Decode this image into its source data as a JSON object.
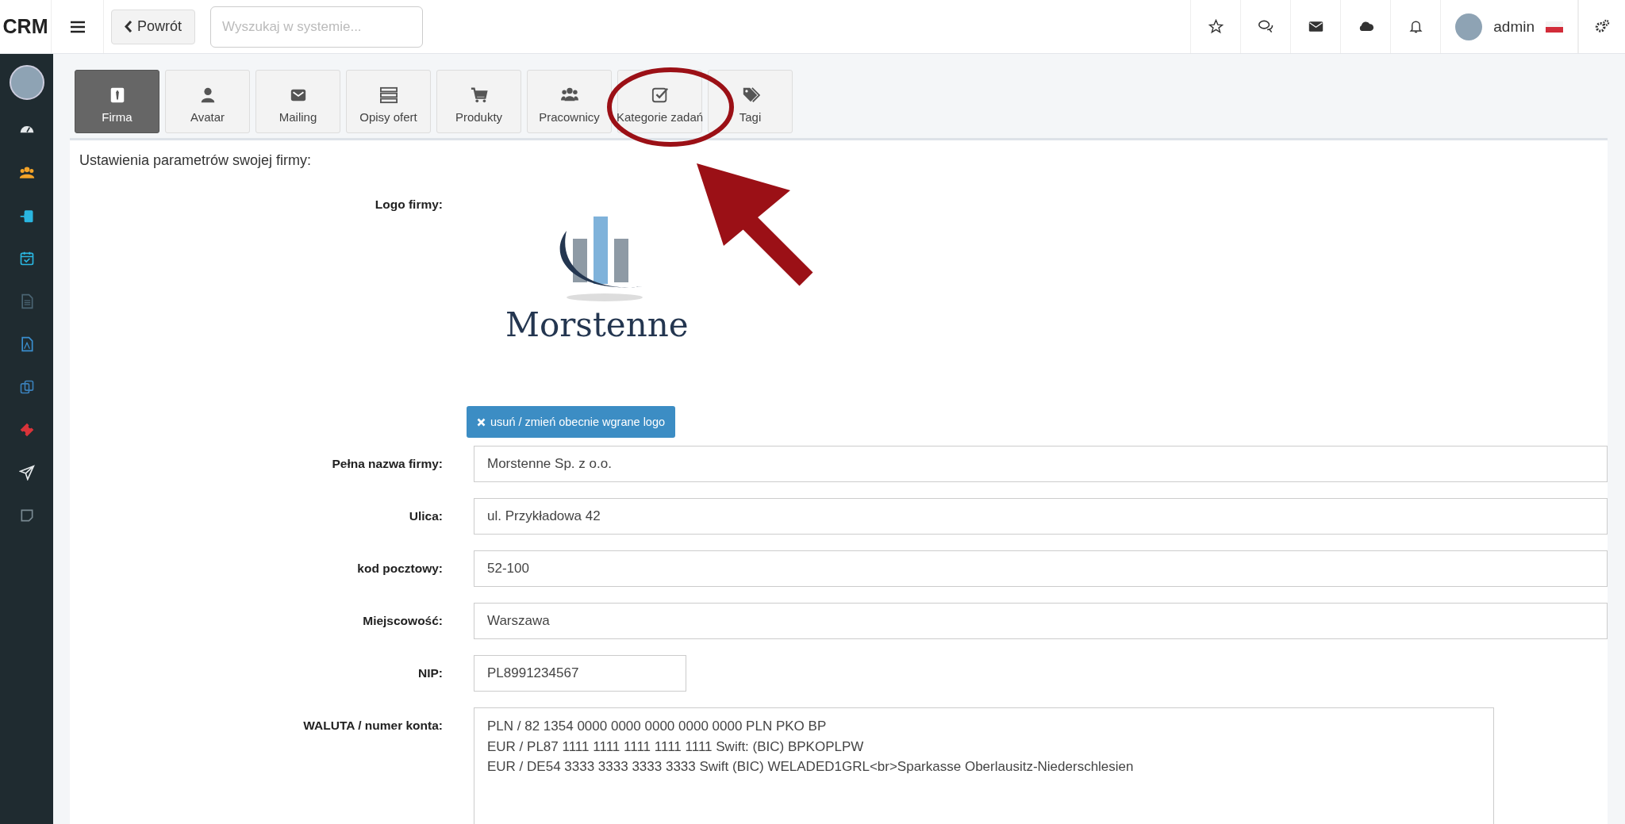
{
  "topbar": {
    "logo": "CRM",
    "back_button": "Powrót",
    "search": {
      "placeholder": "Wyszukaj w systemie..."
    },
    "user": "admin"
  },
  "tabs": [
    {
      "label": "Firma",
      "selected": true
    },
    {
      "label": "Avatar",
      "selected": false
    },
    {
      "label": "Mailing",
      "selected": false
    },
    {
      "label": "Opisy ofert",
      "selected": false
    },
    {
      "label": "Produkty",
      "selected": false
    },
    {
      "label": "Pracownicy",
      "selected": false
    },
    {
      "label": "Kategorie zadań",
      "selected": false
    },
    {
      "label": "Tagi",
      "selected": false
    }
  ],
  "section_title": "Ustawienia parametrów swojej firmy:",
  "logo": {
    "label": "Logo firmy:",
    "wordmark": "Morstenne",
    "button": "usuń / zmień obecnie wgrane logo"
  },
  "fields": [
    {
      "kind": "wide",
      "label": "Pełna nazwa firmy:",
      "value": "Morstenne Sp. z o.o."
    },
    {
      "kind": "wide",
      "label": "Ulica:",
      "value": "ul. Przykładowa 42"
    },
    {
      "kind": "wide",
      "label": "kod pocztowy:",
      "value": "52-100"
    },
    {
      "kind": "wide",
      "label": "Miejscowość:",
      "value": "Warszawa"
    },
    {
      "kind": "short",
      "label": "NIP:",
      "value": "PL8991234567"
    },
    {
      "kind": "textarea",
      "label": "WALUTA / numer konta:",
      "value": "PLN / 82 1354 0000 0000 0000 0000 0000 PLN PKO BP\nEUR / PL87 1111 1111 1111 1111 1111 Swift: (BIC) BPKOPLPW\nEUR / DE54 3333 3333 3333 3333 Swift (BIC) WELADED1GRL<br>Sparkasse Oberlausitz-Niederschlesien"
    }
  ]
}
